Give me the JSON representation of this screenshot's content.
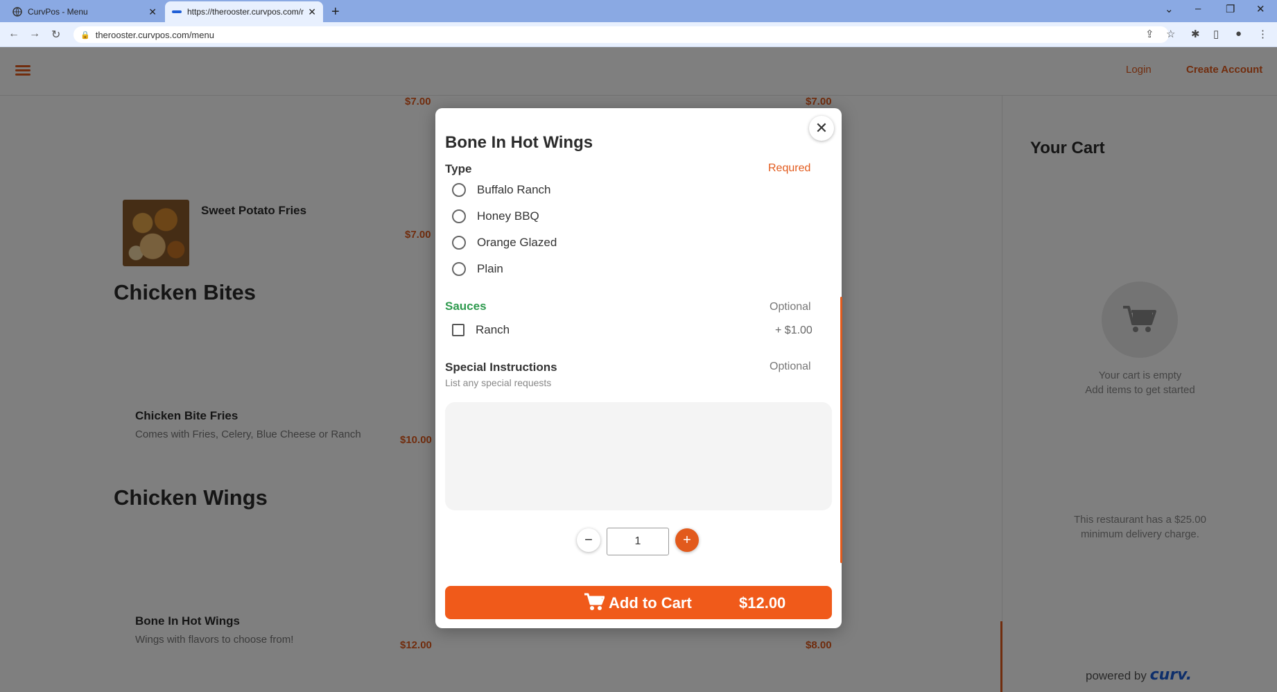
{
  "browser": {
    "tabs": [
      {
        "title": "CurvPos - Menu"
      },
      {
        "title": "https://therooster.curvpos.com/r"
      }
    ],
    "url": "therooster.curvpos.com/menu"
  },
  "header": {
    "login": "Login",
    "create_account": "Create Account"
  },
  "menu": {
    "prices_top": [
      "$7.00",
      "$7.00"
    ],
    "sweet_potato": {
      "name": "Sweet Potato Fries",
      "price": "$7.00"
    },
    "section_bites": "Chicken Bites",
    "bite_fries": {
      "name": "Chicken Bite Fries",
      "desc": "Comes with Fries, Celery, Blue Cheese or Ranch",
      "price": "$10.00"
    },
    "section_wings": "Chicken Wings",
    "bone_in": {
      "name": "Bone In Hot Wings",
      "desc": "Wings with flavors to choose from!",
      "price": "$12.00"
    },
    "other_price": "$8.00"
  },
  "cart": {
    "title": "Your Cart",
    "empty_line1": "Your cart is empty",
    "empty_line2": "Add items to get started",
    "min_line1": "This restaurant has a $25.00",
    "min_line2": "minimum delivery charge.",
    "powered_by": "powered by",
    "brand": "curv."
  },
  "modal": {
    "title": "Bone In Hot Wings",
    "type_label": "Type",
    "type_tag": "Requred",
    "type_options": [
      "Buffalo Ranch",
      "Honey BBQ",
      "Orange Glazed",
      "Plain"
    ],
    "sauces_label": "Sauces",
    "sauces_tag": "Optional",
    "sauce_option": "Ranch",
    "sauce_price": "+ $1.00",
    "si_label": "Special Instructions",
    "si_tag": "Optional",
    "si_sub": "List any special requests",
    "quantity": "1",
    "add_label": "Add to Cart",
    "add_amount": "$12.00"
  },
  "colors": {
    "accent": "#e25a1c",
    "required": "#e25a1c",
    "sauces": "#2e9a4e",
    "brand": "#1f5fd6"
  }
}
